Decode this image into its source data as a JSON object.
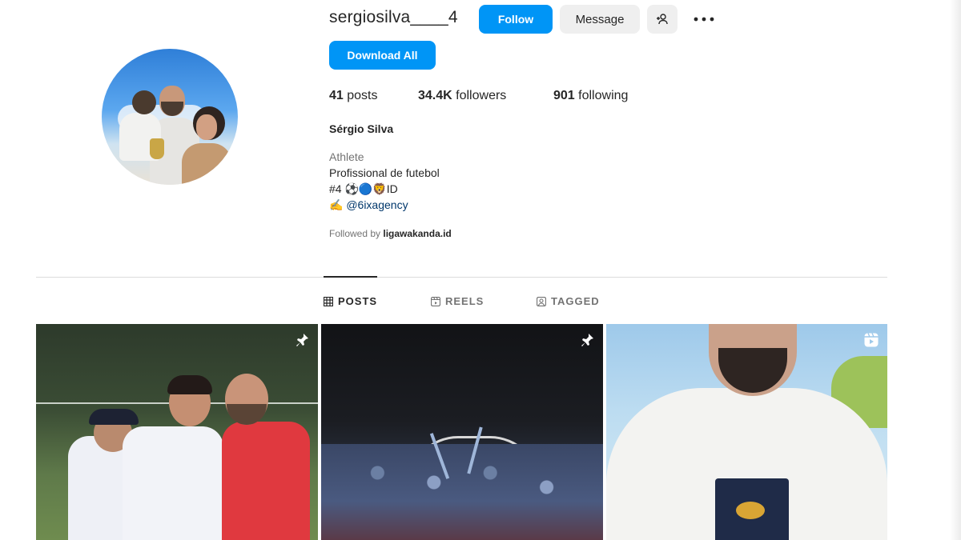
{
  "profile": {
    "username": "sergiosilva____4",
    "follow_label": "Follow",
    "message_label": "Message",
    "download_label": "Download All",
    "stats": {
      "posts_count": "41",
      "posts_label": "posts",
      "followers_count": "34.4K",
      "followers_label": "followers",
      "following_count": "901",
      "following_label": "following"
    },
    "full_name": "Sérgio Silva",
    "category": "Athlete",
    "bio_line1": "Profissional de futebol",
    "bio_line2": "#4 ⚽🔵🦁ID",
    "bio_line3_prefix": "✍",
    "bio_link": "@6ixagency",
    "followed_prefix": "Followed by ",
    "followed_by": "ligawakanda.id"
  },
  "tabs": [
    {
      "label": "POSTS",
      "icon": "grid-icon",
      "active": true
    },
    {
      "label": "REELS",
      "icon": "reels-icon",
      "active": false
    },
    {
      "label": "TAGGED",
      "icon": "tagged-icon",
      "active": false
    }
  ],
  "posts": [
    {
      "badge": "pin-icon"
    },
    {
      "badge": "pin-icon"
    },
    {
      "badge": "reel-icon"
    }
  ],
  "colors": {
    "accent": "#0095f6",
    "button_gray": "#efefef",
    "text_primary": "#262626",
    "text_secondary": "#737373",
    "link": "#00376b"
  }
}
